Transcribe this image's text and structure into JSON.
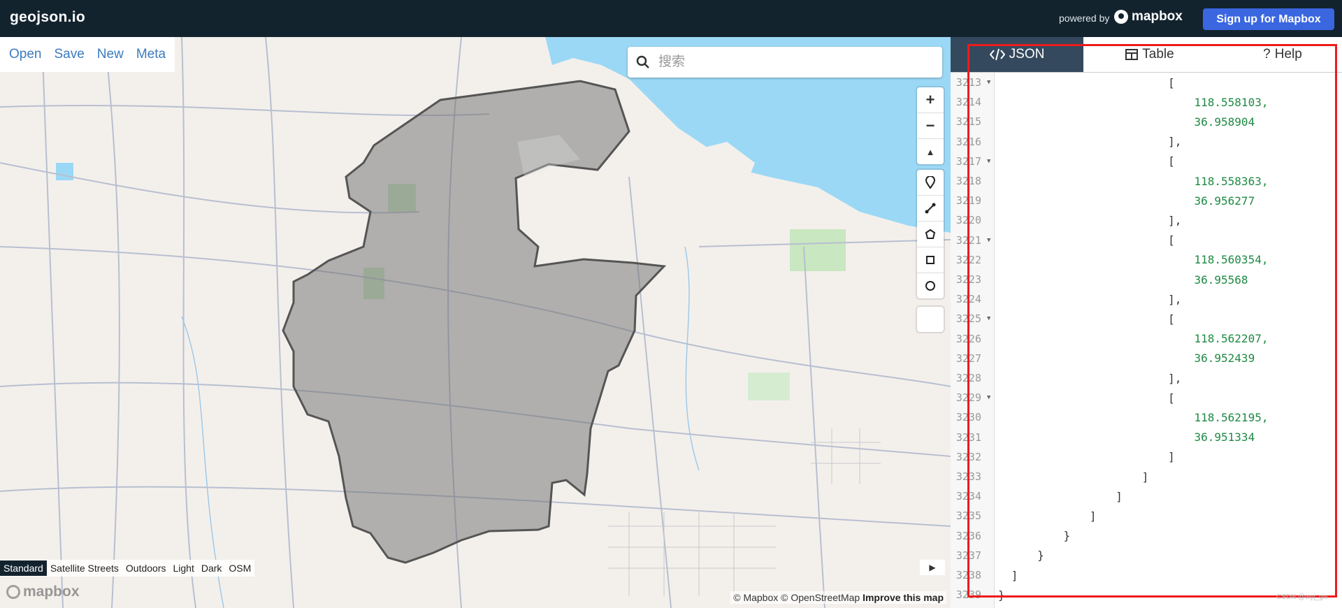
{
  "header": {
    "brand": "geojson.io",
    "powered_by": "powered by",
    "mapbox_logo": "mapbox",
    "signup_label": "Sign up for Mapbox"
  },
  "map": {
    "menu": [
      "Open",
      "Save",
      "New",
      "Meta"
    ],
    "search_placeholder": "搜索",
    "zoom_in": "+",
    "zoom_out": "−",
    "north": "▲",
    "styles": [
      "Standard",
      "Satellite Streets",
      "Outdoors",
      "Light",
      "Dark",
      "OSM"
    ],
    "active_style": "Standard",
    "watermark": "mapbox",
    "attribution": {
      "mapbox": "© Mapbox",
      "osm": "© OpenStreetMap",
      "improve": "Improve this map"
    },
    "collapse_arrow": "▶"
  },
  "panel": {
    "tabs": [
      {
        "label": "JSON",
        "icon": "code-icon"
      },
      {
        "label": "Table",
        "icon": "table-icon"
      },
      {
        "label": "Help",
        "icon": "help-icon"
      }
    ],
    "active_tab": "JSON",
    "lines": [
      {
        "n": "3213",
        "fold": true,
        "indent": 13,
        "text": "["
      },
      {
        "n": "3214",
        "fold": false,
        "indent": 15,
        "text": "118.558103,",
        "num": true
      },
      {
        "n": "3215",
        "fold": false,
        "indent": 15,
        "text": "36.958904",
        "num": true
      },
      {
        "n": "3216",
        "fold": false,
        "indent": 13,
        "text": "],"
      },
      {
        "n": "3217",
        "fold": true,
        "indent": 13,
        "text": "["
      },
      {
        "n": "3218",
        "fold": false,
        "indent": 15,
        "text": "118.558363,",
        "num": true
      },
      {
        "n": "3219",
        "fold": false,
        "indent": 15,
        "text": "36.956277",
        "num": true
      },
      {
        "n": "3220",
        "fold": false,
        "indent": 13,
        "text": "],"
      },
      {
        "n": "3221",
        "fold": true,
        "indent": 13,
        "text": "["
      },
      {
        "n": "3222",
        "fold": false,
        "indent": 15,
        "text": "118.560354,",
        "num": true
      },
      {
        "n": "3223",
        "fold": false,
        "indent": 15,
        "text": "36.95568",
        "num": true
      },
      {
        "n": "3224",
        "fold": false,
        "indent": 13,
        "text": "],"
      },
      {
        "n": "3225",
        "fold": true,
        "indent": 13,
        "text": "["
      },
      {
        "n": "3226",
        "fold": false,
        "indent": 15,
        "text": "118.562207,",
        "num": true
      },
      {
        "n": "3227",
        "fold": false,
        "indent": 15,
        "text": "36.952439",
        "num": true
      },
      {
        "n": "3228",
        "fold": false,
        "indent": 13,
        "text": "],"
      },
      {
        "n": "3229",
        "fold": true,
        "indent": 13,
        "text": "["
      },
      {
        "n": "3230",
        "fold": false,
        "indent": 15,
        "text": "118.562195,",
        "num": true
      },
      {
        "n": "3231",
        "fold": false,
        "indent": 15,
        "text": "36.951334",
        "num": true
      },
      {
        "n": "3232",
        "fold": false,
        "indent": 13,
        "text": "]"
      },
      {
        "n": "3233",
        "fold": false,
        "indent": 11,
        "text": "]"
      },
      {
        "n": "3234",
        "fold": false,
        "indent": 9,
        "text": "]"
      },
      {
        "n": "3235",
        "fold": false,
        "indent": 7,
        "text": "]"
      },
      {
        "n": "3236",
        "fold": false,
        "indent": 5,
        "text": "}"
      },
      {
        "n": "3237",
        "fold": false,
        "indent": 3,
        "text": "}"
      },
      {
        "n": "3238",
        "fold": false,
        "indent": 1,
        "text": "]"
      },
      {
        "n": "3239",
        "fold": false,
        "indent": 0,
        "text": "}"
      }
    ]
  },
  "annotation_color": "#ee1b1b",
  "watermark": "CSDN @wyj_gis"
}
